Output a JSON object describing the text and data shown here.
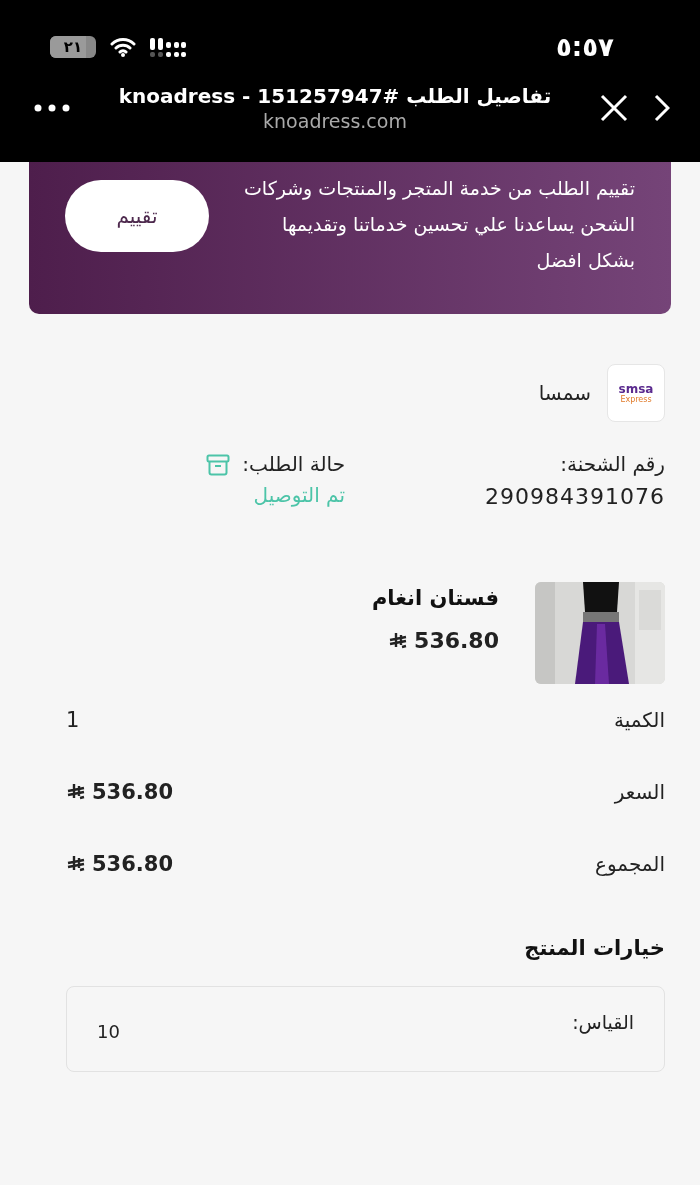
{
  "status_bar": {
    "time": "٥:٥٧",
    "battery": "٢١"
  },
  "browser": {
    "title": "تفاصيل الطلب #151257947 - knoadress",
    "url": "knoadress.com"
  },
  "rating_card": {
    "text": "تقييم الطلب من خدمة المتجر والمنتجات وشركات الشحن يساعدنا علي تحسين خدماتنا وتقديمها بشكل افضل",
    "button": "تقييم"
  },
  "carrier": {
    "name": "سمسا",
    "logo_text": "smsa",
    "logo_subtext": "Express"
  },
  "shipment": {
    "label": "رقم الشحنة:",
    "number": "290984391076"
  },
  "order_status": {
    "label": "حالة الطلب:",
    "value": "تم التوصيل"
  },
  "product": {
    "name": "فستان انغام",
    "price": "536.80"
  },
  "summary": [
    {
      "label": "الكمية",
      "value": "1",
      "currency": false
    },
    {
      "label": "السعر",
      "value": "536.80",
      "currency": true
    },
    {
      "label": "المجموع",
      "value": "536.80",
      "currency": true
    }
  ],
  "options": {
    "title": "خيارات المنتج",
    "items": [
      {
        "label": "القياس:",
        "value": "10"
      }
    ]
  }
}
